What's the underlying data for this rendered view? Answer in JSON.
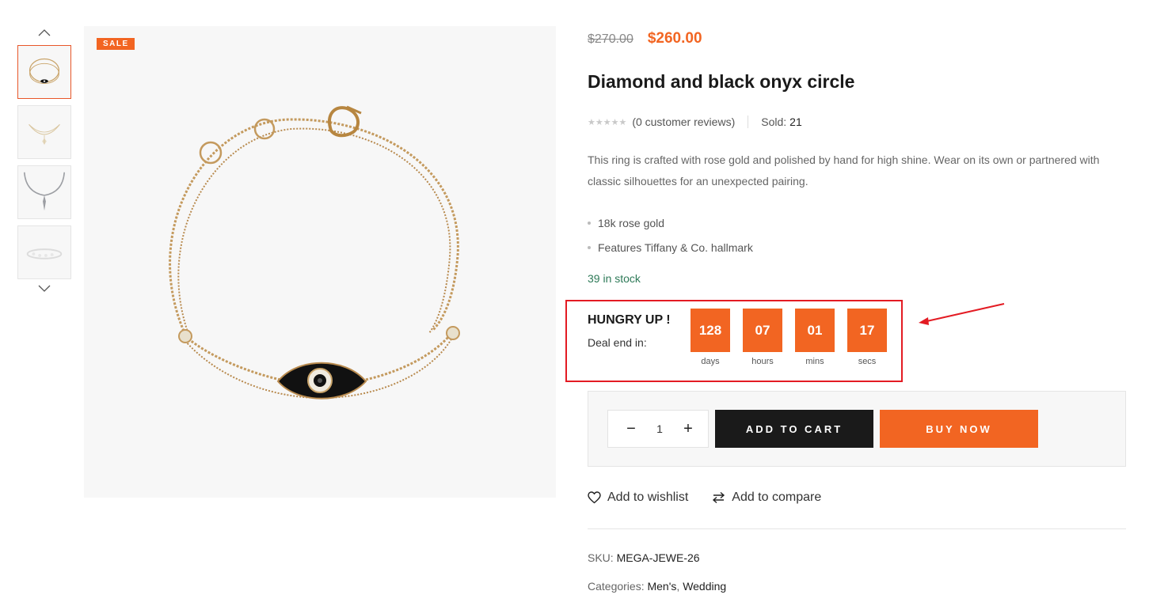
{
  "thumbnails": {
    "up_icon": "chevron-up-icon",
    "down_icon": "chevron-down-icon",
    "items": [
      {
        "label": "thumb-1",
        "active": true
      },
      {
        "label": "thumb-2",
        "active": false
      },
      {
        "label": "thumb-3",
        "active": false
      },
      {
        "label": "thumb-4",
        "active": false
      }
    ]
  },
  "badge": "SALE",
  "product": {
    "old_price": "$270.00",
    "new_price": "$260.00",
    "title": "Diamond and black onyx circle",
    "stars": "★★★★★",
    "reviews": "(0 customer reviews)",
    "sold_label": "Sold:",
    "sold_value": "21",
    "description": "This ring is crafted with rose gold and polished by hand for high shine. Wear on its own or partnered with classic silhouettes for an unexpected pairing.",
    "features": [
      "18k rose gold",
      "Features Tiffany & Co. hallmark"
    ],
    "stock": "39 in stock"
  },
  "countdown": {
    "heading": "HUNGRY UP !",
    "subheading": "Deal end in:",
    "units": [
      {
        "value": "128",
        "label": "days"
      },
      {
        "value": "07",
        "label": "hours"
      },
      {
        "value": "01",
        "label": "mins"
      },
      {
        "value": "17",
        "label": "secs"
      }
    ]
  },
  "cart": {
    "minus": "−",
    "plus": "+",
    "quantity": "1",
    "add_to_cart": "ADD TO CART",
    "buy_now": "BUY NOW"
  },
  "actions": {
    "wishlist": "Add to wishlist",
    "compare": "Add to compare"
  },
  "meta": {
    "sku_label": "SKU:",
    "sku_value": "MEGA-JEWE-26",
    "categories_label": "Categories:",
    "categories": [
      "Men's",
      "Wedding"
    ]
  },
  "colors": {
    "accent": "#f26522",
    "annotation": "#e31b23",
    "stock": "#2e7a58",
    "dark_button": "#1a1a1a"
  }
}
